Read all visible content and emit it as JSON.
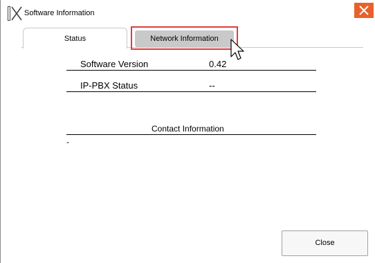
{
  "window": {
    "title": "Software Information"
  },
  "tabs": [
    {
      "label": "Status",
      "selected": true
    },
    {
      "label": "Network Information",
      "selected": false,
      "highlighted": true
    }
  ],
  "status": {
    "rows": [
      {
        "label": "Software Version",
        "value": "0.42"
      },
      {
        "label": "IP-PBX Status",
        "value": "--"
      }
    ],
    "contact_heading": "Contact Information",
    "contact_text": "-"
  },
  "footer": {
    "close_label": "Close"
  },
  "colors": {
    "close_x_bg": "#e8612c",
    "tab_highlight_border": "#e03b3b",
    "inactive_tab_bg": "#c9c9c9"
  },
  "icons": {
    "app": "ix-logo-icon",
    "window_close": "close-icon",
    "pointer": "mouse-cursor-icon"
  }
}
